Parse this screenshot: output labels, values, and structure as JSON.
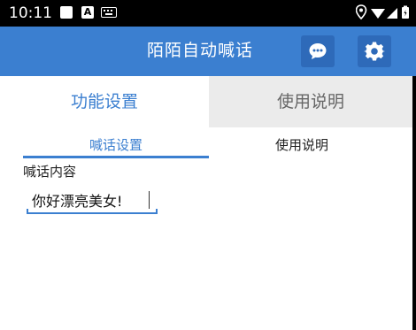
{
  "status_bar": {
    "time": "10:11",
    "notification_icons": [
      "white-square-icon",
      "a-icon",
      "keyboard-icon"
    ],
    "system_icons": [
      "location-icon",
      "wifi-icon",
      "signal-icon",
      "battery-icon"
    ]
  },
  "app_bar": {
    "title": "陌陌自动喊话",
    "background_color": "#3b7fd0",
    "buttons": [
      "chat-icon",
      "gear-icon"
    ]
  },
  "main_tabs": [
    {
      "label": "功能设置",
      "active": true
    },
    {
      "label": "使用说明",
      "active": false
    }
  ],
  "sub_tabs": [
    {
      "label": "喊话设置",
      "active": true
    },
    {
      "label": "使用说明",
      "active": false
    }
  ],
  "form": {
    "label": "喊话内容",
    "value": "你好漂亮美女!"
  },
  "colors": {
    "accent": "#3b7fd0",
    "inactive_tab_bg": "#ebebeb"
  }
}
